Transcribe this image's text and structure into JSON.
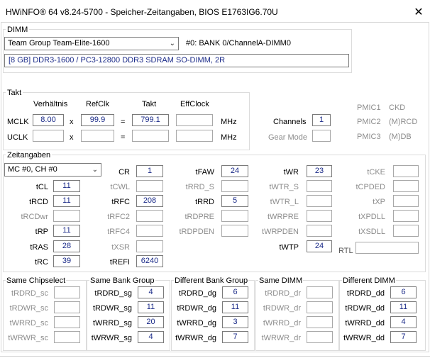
{
  "window": {
    "title": "HWiNFO® 64 v8.24-5700 - Speicher-Zeitangaben, BIOS E1763IG6.70U",
    "close_glyph": "✕"
  },
  "dimm": {
    "group_label": "DIMM",
    "module_select": "Team Group Team-Elite-1600",
    "bank_label": "#0: BANK 0/ChannelA-DIMM0",
    "spec": "[8 GB] DDR3-1600 / PC3-12800 DDR3 SDRAM SO-DIMM, 2R"
  },
  "takt": {
    "group_label": "Takt",
    "headers": {
      "ratio": "Verhältnis",
      "refclk": "RefClk",
      "takt": "Takt",
      "effclock": "EffClock"
    },
    "rows": [
      {
        "label": "MCLK",
        "ratio": "8.00",
        "refclk": "99.9",
        "takt": "799.1",
        "effclock": "",
        "unit": "MHz"
      },
      {
        "label": "UCLK",
        "ratio": "",
        "refclk": "",
        "takt": "",
        "effclock": "",
        "unit": "MHz"
      }
    ],
    "op_mul": "x",
    "op_eq": "=",
    "channels_label": "Channels",
    "channels_value": "1",
    "gear_mode_label": "Gear Mode",
    "gear_mode_value": "",
    "pmic": [
      {
        "label": "PMIC1",
        "value": "CKD"
      },
      {
        "label": "PMIC2",
        "value": "(M)RCD"
      },
      {
        "label": "PMIC3",
        "value": "(M)DB"
      }
    ]
  },
  "zeit": {
    "group_label": "Zeitangaben",
    "channel_select": "MC #0, CH #0",
    "col1": [
      {
        "label": "tCL",
        "value": "11",
        "dim": false
      },
      {
        "label": "tRCD",
        "value": "11",
        "dim": false
      },
      {
        "label": "tRCDwr",
        "value": "",
        "dim": true
      },
      {
        "label": "tRP",
        "value": "11",
        "dim": false
      },
      {
        "label": "tRAS",
        "value": "28",
        "dim": false
      },
      {
        "label": "tRC",
        "value": "39",
        "dim": false
      }
    ],
    "col2": [
      {
        "label": "CR",
        "value": "1",
        "dim": false
      },
      {
        "label": "tCWL",
        "value": "",
        "dim": true
      },
      {
        "label": "tRFC",
        "value": "208",
        "dim": false
      },
      {
        "label": "tRFC2",
        "value": "",
        "dim": true
      },
      {
        "label": "tRFC4",
        "value": "",
        "dim": true
      },
      {
        "label": "tXSR",
        "value": "",
        "dim": true
      },
      {
        "label": "tREFI",
        "value": "6240",
        "dim": false
      }
    ],
    "col3": [
      {
        "label": "tFAW",
        "value": "24",
        "dim": false
      },
      {
        "label": "tRRD_S",
        "value": "",
        "dim": true
      },
      {
        "label": "tRRD",
        "value": "5",
        "dim": false
      },
      {
        "label": "tRDPRE",
        "value": "",
        "dim": true
      },
      {
        "label": "tRDPDEN",
        "value": "",
        "dim": true
      }
    ],
    "col4": [
      {
        "label": "tWR",
        "value": "23",
        "dim": false
      },
      {
        "label": "tWTR_S",
        "value": "",
        "dim": true
      },
      {
        "label": "tWTR_L",
        "value": "",
        "dim": true
      },
      {
        "label": "tWRPRE",
        "value": "",
        "dim": true
      },
      {
        "label": "tWRPDEN",
        "value": "",
        "dim": true
      },
      {
        "label": "tWTP",
        "value": "24",
        "dim": false
      }
    ],
    "col5": [
      {
        "label": "tCKE",
        "value": "",
        "dim": true
      },
      {
        "label": "tCPDED",
        "value": "",
        "dim": true
      },
      {
        "label": "tXP",
        "value": "",
        "dim": true
      },
      {
        "label": "tXPDLL",
        "value": "",
        "dim": true
      },
      {
        "label": "tXSDLL",
        "value": "",
        "dim": true
      }
    ],
    "rtl_label": "RTL",
    "rtl_value": ""
  },
  "bottom_groups": [
    {
      "title": "Same Chipselect",
      "rows": [
        {
          "label": "tRDRD_sc",
          "value": "",
          "dim": true
        },
        {
          "label": "tRDWR_sc",
          "value": "",
          "dim": true
        },
        {
          "label": "tWRRD_sc",
          "value": "",
          "dim": true
        },
        {
          "label": "tWRWR_sc",
          "value": "",
          "dim": true
        }
      ]
    },
    {
      "title": "Same Bank Group",
      "rows": [
        {
          "label": "tRDRD_sg",
          "value": "4",
          "dim": false
        },
        {
          "label": "tRDWR_sg",
          "value": "11",
          "dim": false
        },
        {
          "label": "tWRRD_sg",
          "value": "20",
          "dim": false
        },
        {
          "label": "tWRWR_sg",
          "value": "4",
          "dim": false
        }
      ]
    },
    {
      "title": "Different Bank Group",
      "rows": [
        {
          "label": "tRDRD_dg",
          "value": "6",
          "dim": false
        },
        {
          "label": "tRDWR_dg",
          "value": "11",
          "dim": false
        },
        {
          "label": "tWRRD_dg",
          "value": "3",
          "dim": false
        },
        {
          "label": "tWRWR_dg",
          "value": "7",
          "dim": false
        }
      ]
    },
    {
      "title": "Same DIMM",
      "rows": [
        {
          "label": "tRDRD_dr",
          "value": "",
          "dim": true
        },
        {
          "label": "tRDWR_dr",
          "value": "",
          "dim": true
        },
        {
          "label": "tWRRD_dr",
          "value": "",
          "dim": true
        },
        {
          "label": "tWRWR_dr",
          "value": "",
          "dim": true
        }
      ]
    },
    {
      "title": "Different DIMM",
      "rows": [
        {
          "label": "tRDRD_dd",
          "value": "6",
          "dim": false
        },
        {
          "label": "tRDWR_dd",
          "value": "11",
          "dim": false
        },
        {
          "label": "tWRRD_dd",
          "value": "4",
          "dim": false
        },
        {
          "label": "tWRWR_dd",
          "value": "7",
          "dim": false
        }
      ]
    }
  ]
}
